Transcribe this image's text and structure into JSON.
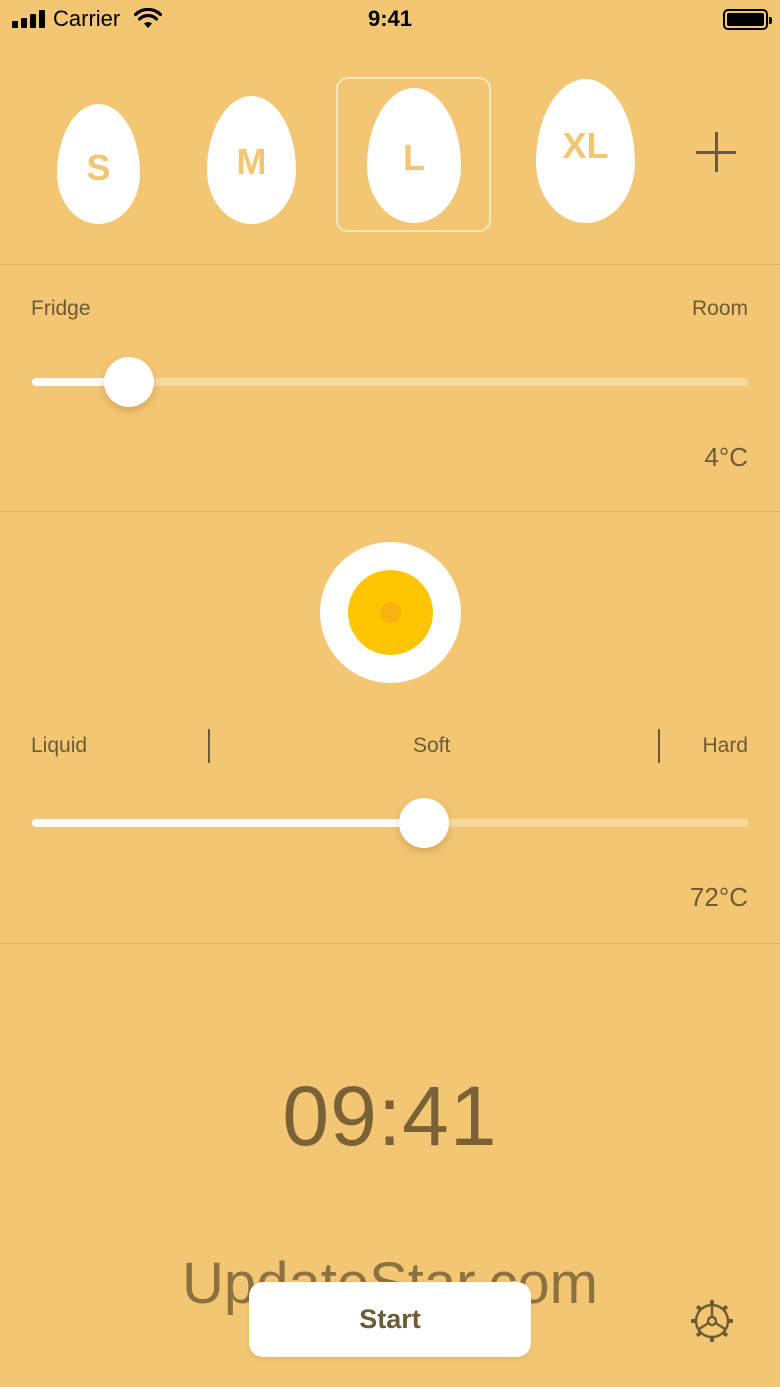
{
  "status_bar": {
    "carrier": "Carrier",
    "time": "9:41",
    "signal_icon": "cellular-signal-icon",
    "wifi_icon": "wifi-icon",
    "battery_icon": "battery-icon"
  },
  "egg_sizes": {
    "items": [
      {
        "label": "S"
      },
      {
        "label": "M"
      },
      {
        "label": "L"
      },
      {
        "label": "XL"
      }
    ],
    "selected": "L",
    "add_icon": "plus-icon"
  },
  "start_temperature": {
    "min_label": "Fridge",
    "max_label": "Room",
    "value": "4°C",
    "level": 0.136
  },
  "doneness": {
    "egg_icon": "egg-cross-section-icon",
    "labels": [
      "Liquid",
      "Soft",
      "Hard"
    ],
    "value": "72°C",
    "level": 0.548
  },
  "timer": {
    "display": "09:41"
  },
  "watermark": "UpdateStar.com",
  "actions": {
    "start_label": "Start",
    "settings_icon": "settings-gear-icon"
  },
  "colors": {
    "background": "#F3C673",
    "text": "#6E5A33",
    "yolk": "#FCC500",
    "track": "#F7D99E"
  }
}
